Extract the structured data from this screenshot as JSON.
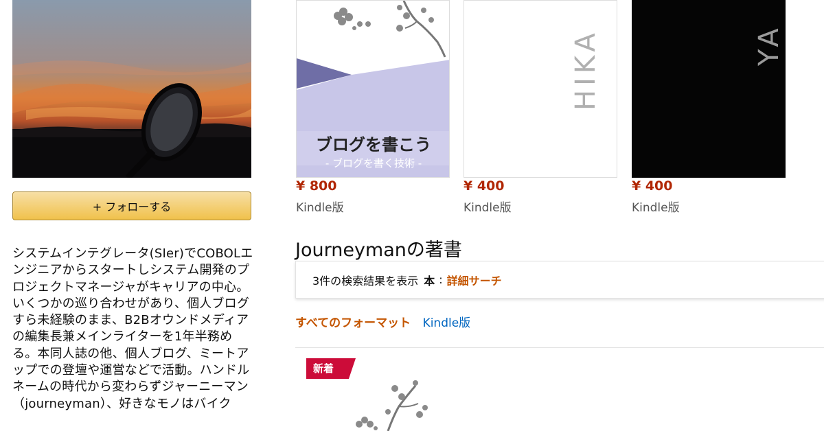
{
  "author": {
    "follow_label": "+ フォローする",
    "bio": "システムインテグレータ(SIer)でCOBOLエンジニアからスタートしシステム開発のプロジェクトマネージャがキャリアの中心。いくつかの巡り合わせがあり、個人ブログすら未経験のまま、B2Bオウンドメディアの編集長兼メインライターを1年半務める。本同人誌の他、個人ブログ、ミートアップでの登壇や運営などで活動。ハンドルネームの時代から変わらずジャーニーマン（journeyman）、好きなモノはバイク"
  },
  "top_books": [
    {
      "cover_title": "ブログを書こう",
      "cover_subtitle": "- ブログを書く技術 -",
      "price": "¥ 800",
      "format": "Kindle版"
    },
    {
      "cover_text": "HIKA",
      "price": "¥ 400",
      "format": "Kindle版"
    },
    {
      "cover_text": "YA",
      "price": "¥ 400",
      "format": "Kindle版"
    }
  ],
  "section": {
    "title": "Journeymanの著書",
    "results_text": "3件の検索結果を表示",
    "category": "本",
    "colon": ":",
    "advanced_search": "詳細サーチ",
    "format_all": "すべてのフォーマット",
    "format_kindle": "Kindle版"
  },
  "badge": {
    "new_label": "新着"
  },
  "colors": {
    "price": "#b12704",
    "link_orange": "#c45500",
    "link_blue": "#0066c0",
    "follow_button": "#f0c14b",
    "new_badge": "#cc0c39",
    "cover_lavender": "#c8c6e8",
    "cover_indigo": "#6f6ea6"
  }
}
